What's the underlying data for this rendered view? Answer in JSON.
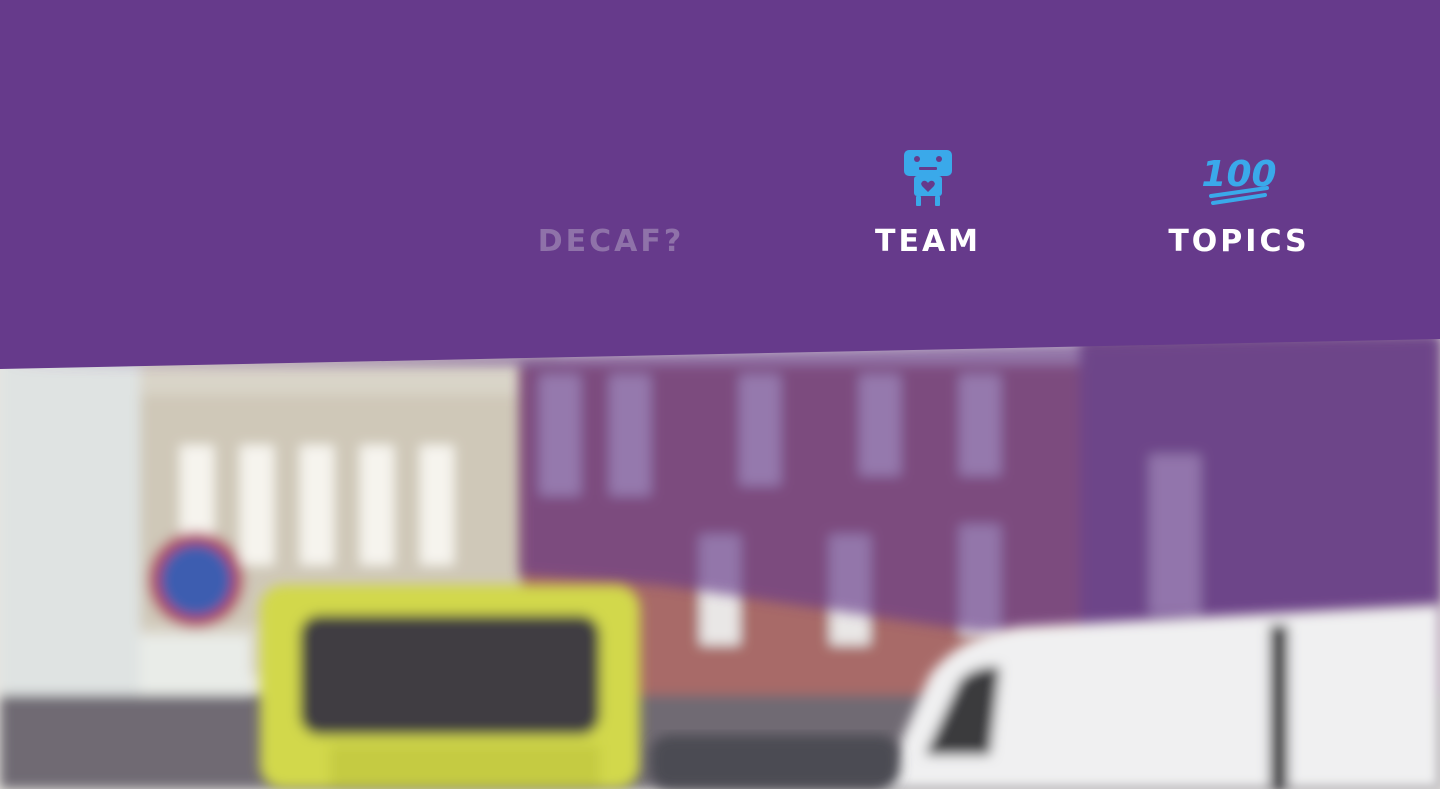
{
  "nav": {
    "items": [
      {
        "label": "DECAF?",
        "icon": "none",
        "active": false
      },
      {
        "label": "TEAM",
        "icon": "robot-icon",
        "active": true
      },
      {
        "label": "TOPICS",
        "icon": "hundred-points-icon",
        "active": true
      }
    ],
    "icon_color": "#3aa9ea",
    "icon_text": "100"
  },
  "colors": {
    "header_purple": "#663a8b",
    "inactive_label": "#8f72a9",
    "active_label": "#ffffff"
  },
  "hero": {
    "description_icon": "street-photo-icon"
  }
}
